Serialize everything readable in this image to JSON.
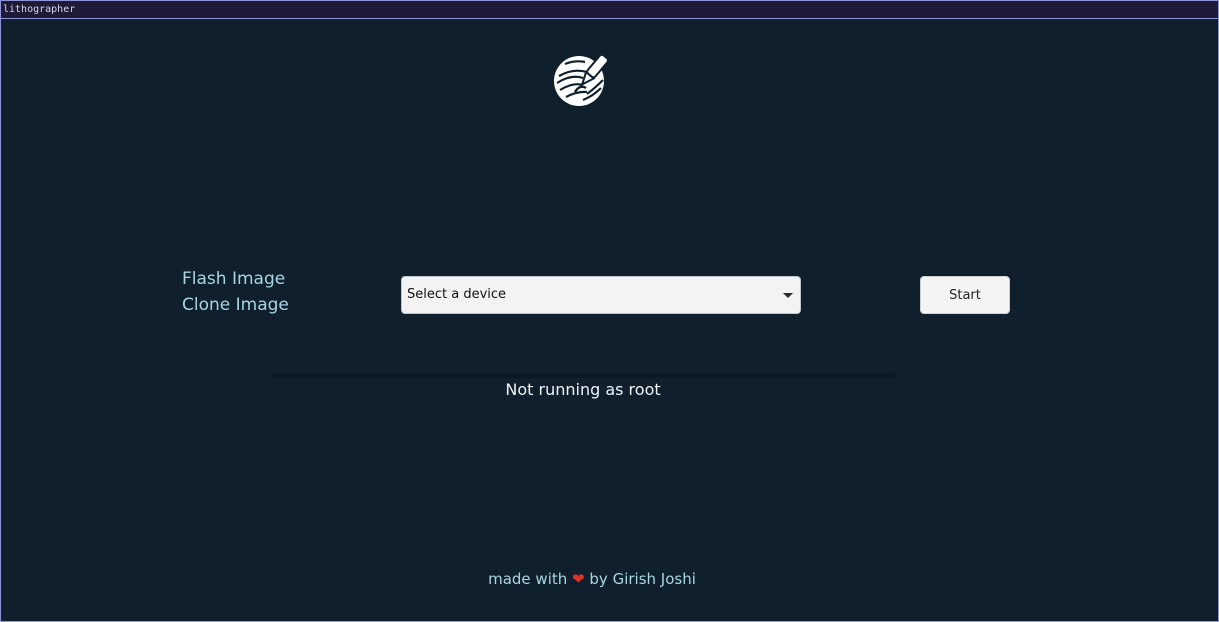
{
  "window": {
    "title": "lithographer"
  },
  "logo": {
    "icon": "pen-nib-on-layers-logo"
  },
  "modes": [
    {
      "label": "Flash Image"
    },
    {
      "label": "Clone Image"
    }
  ],
  "device_select": {
    "selected": "Select a device"
  },
  "actions": {
    "start_label": "Start"
  },
  "progress": {
    "value": 0
  },
  "status": {
    "text": "Not running as root"
  },
  "footer": {
    "prefix": "made with",
    "heart": "❤",
    "suffix": "by Girish Joshi"
  },
  "colors": {
    "background": "#0f1f2c",
    "accent_text": "#a9d5e3",
    "heart": "#e0322b"
  }
}
